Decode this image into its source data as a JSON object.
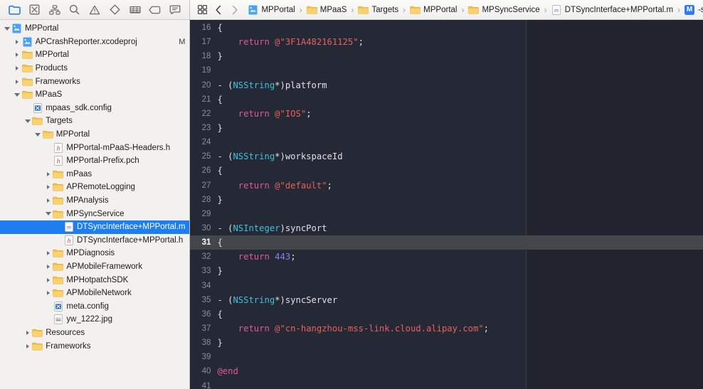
{
  "navigator": {
    "toolbar_icons": [
      {
        "name": "project-navigator-icon",
        "label": "Project Navigator",
        "selected": true
      },
      {
        "name": "source-control-navigator-icon",
        "label": "Source Control Navigator",
        "selected": false
      },
      {
        "name": "symbol-navigator-icon",
        "label": "Symbol Navigator",
        "selected": false
      },
      {
        "name": "find-navigator-icon",
        "label": "Find Navigator",
        "selected": false
      },
      {
        "name": "issue-navigator-icon",
        "label": "Issue Navigator",
        "selected": false
      },
      {
        "name": "test-navigator-icon",
        "label": "Test Navigator",
        "selected": false
      },
      {
        "name": "debug-navigator-icon",
        "label": "Debug Navigator",
        "selected": false
      },
      {
        "name": "breakpoint-navigator-icon",
        "label": "Breakpoint Navigator",
        "selected": false
      },
      {
        "name": "report-navigator-icon",
        "label": "Report Navigator",
        "selected": false
      }
    ],
    "tree": [
      {
        "label": "MPPortal",
        "depth": 0,
        "icon": "xcode-project",
        "state": "open",
        "selected": false,
        "badge": ""
      },
      {
        "label": "APCrashReporter.xcodeproj",
        "depth": 1,
        "icon": "xcode-project",
        "state": "closed",
        "selected": false,
        "badge": "M"
      },
      {
        "label": "MPPortal",
        "depth": 1,
        "icon": "folder",
        "state": "closed",
        "selected": false,
        "badge": ""
      },
      {
        "label": "Products",
        "depth": 1,
        "icon": "folder",
        "state": "closed",
        "selected": false,
        "badge": ""
      },
      {
        "label": "Frameworks",
        "depth": 1,
        "icon": "folder",
        "state": "closed",
        "selected": false,
        "badge": ""
      },
      {
        "label": "MPaaS",
        "depth": 1,
        "icon": "folder",
        "state": "open",
        "selected": false,
        "badge": ""
      },
      {
        "label": "mpaas_sdk.config",
        "depth": 2,
        "icon": "config",
        "state": "none",
        "selected": false,
        "badge": ""
      },
      {
        "label": "Targets",
        "depth": 2,
        "icon": "folder",
        "state": "open",
        "selected": false,
        "badge": ""
      },
      {
        "label": "MPPortal",
        "depth": 3,
        "icon": "folder",
        "state": "open",
        "selected": false,
        "badge": ""
      },
      {
        "label": "MPPortal-mPaaS-Headers.h",
        "depth": 4,
        "icon": "header",
        "state": "none",
        "selected": false,
        "badge": ""
      },
      {
        "label": "MPPortal-Prefix.pch",
        "depth": 4,
        "icon": "header",
        "state": "none",
        "selected": false,
        "badge": ""
      },
      {
        "label": "mPaas",
        "depth": 4,
        "icon": "folder",
        "state": "closed",
        "selected": false,
        "badge": ""
      },
      {
        "label": "APRemoteLogging",
        "depth": 4,
        "icon": "folder",
        "state": "closed",
        "selected": false,
        "badge": ""
      },
      {
        "label": "MPAnalysis",
        "depth": 4,
        "icon": "folder",
        "state": "closed",
        "selected": false,
        "badge": ""
      },
      {
        "label": "MPSyncService",
        "depth": 4,
        "icon": "folder",
        "state": "open",
        "selected": false,
        "badge": ""
      },
      {
        "label": "DTSyncInterface+MPPortal.m",
        "depth": 5,
        "icon": "source-m",
        "state": "none",
        "selected": true,
        "badge": ""
      },
      {
        "label": "DTSyncInterface+MPPortal.h",
        "depth": 5,
        "icon": "header",
        "state": "none",
        "selected": false,
        "badge": ""
      },
      {
        "label": "MPDiagnosis",
        "depth": 4,
        "icon": "folder",
        "state": "closed",
        "selected": false,
        "badge": ""
      },
      {
        "label": "APMobileFramework",
        "depth": 4,
        "icon": "folder",
        "state": "closed",
        "selected": false,
        "badge": ""
      },
      {
        "label": "MPHotpatchSDK",
        "depth": 4,
        "icon": "folder",
        "state": "closed",
        "selected": false,
        "badge": ""
      },
      {
        "label": "APMobileNetwork",
        "depth": 4,
        "icon": "folder",
        "state": "closed",
        "selected": false,
        "badge": ""
      },
      {
        "label": "meta.config",
        "depth": 4,
        "icon": "config",
        "state": "none",
        "selected": false,
        "badge": ""
      },
      {
        "label": "yw_1222.jpg",
        "depth": 4,
        "icon": "image",
        "state": "none",
        "selected": false,
        "badge": ""
      },
      {
        "label": "Resources",
        "depth": 2,
        "icon": "folder",
        "state": "closed",
        "selected": false,
        "badge": ""
      },
      {
        "label": "Frameworks",
        "depth": 2,
        "icon": "folder",
        "state": "closed",
        "selected": false,
        "badge": ""
      }
    ]
  },
  "jumpbar": {
    "related_items_icon": "related-items-icon",
    "back_icon": "chevron-left-icon",
    "forward_icon": "chevron-right-icon",
    "separator": "›",
    "breadcrumbs": [
      {
        "label": "MPPortal",
        "icon": "xcode-project"
      },
      {
        "label": "MPaaS",
        "icon": "folder"
      },
      {
        "label": "Targets",
        "icon": "folder"
      },
      {
        "label": "MPPortal",
        "icon": "folder"
      },
      {
        "label": "MPSyncService",
        "icon": "folder"
      },
      {
        "label": "DTSyncInterface+MPPortal.m",
        "icon": "source-m"
      },
      {
        "label": "-syncPort",
        "icon": "method-badge"
      }
    ],
    "method_badge_text": "M"
  },
  "editor": {
    "first_line_number": 16,
    "current_line": 31,
    "lines": [
      {
        "n": 16,
        "tokens": [
          {
            "t": "{",
            "c": "plain"
          }
        ]
      },
      {
        "n": 17,
        "tokens": [
          {
            "t": "    ",
            "c": "plain"
          },
          {
            "t": "return",
            "c": "kw"
          },
          {
            "t": " ",
            "c": "plain"
          },
          {
            "t": "@\"3F1A482161125\"",
            "c": "str"
          },
          {
            "t": ";",
            "c": "plain"
          }
        ]
      },
      {
        "n": 18,
        "tokens": [
          {
            "t": "}",
            "c": "plain"
          }
        ]
      },
      {
        "n": 19,
        "tokens": []
      },
      {
        "n": 20,
        "tokens": [
          {
            "t": "- (",
            "c": "plain"
          },
          {
            "t": "NSString",
            "c": "type"
          },
          {
            "t": "*)platform",
            "c": "plain"
          }
        ]
      },
      {
        "n": 21,
        "tokens": [
          {
            "t": "{",
            "c": "plain"
          }
        ]
      },
      {
        "n": 22,
        "tokens": [
          {
            "t": "    ",
            "c": "plain"
          },
          {
            "t": "return",
            "c": "kw"
          },
          {
            "t": " ",
            "c": "plain"
          },
          {
            "t": "@\"IOS\"",
            "c": "str"
          },
          {
            "t": ";",
            "c": "plain"
          }
        ]
      },
      {
        "n": 23,
        "tokens": [
          {
            "t": "}",
            "c": "plain"
          }
        ]
      },
      {
        "n": 24,
        "tokens": []
      },
      {
        "n": 25,
        "tokens": [
          {
            "t": "- (",
            "c": "plain"
          },
          {
            "t": "NSString",
            "c": "type"
          },
          {
            "t": "*)workspaceId",
            "c": "plain"
          }
        ]
      },
      {
        "n": 26,
        "tokens": [
          {
            "t": "{",
            "c": "plain"
          }
        ]
      },
      {
        "n": 27,
        "tokens": [
          {
            "t": "    ",
            "c": "plain"
          },
          {
            "t": "return",
            "c": "kw"
          },
          {
            "t": " ",
            "c": "plain"
          },
          {
            "t": "@\"default\"",
            "c": "str"
          },
          {
            "t": ";",
            "c": "plain"
          }
        ]
      },
      {
        "n": 28,
        "tokens": [
          {
            "t": "}",
            "c": "plain"
          }
        ]
      },
      {
        "n": 29,
        "tokens": []
      },
      {
        "n": 30,
        "tokens": [
          {
            "t": "- (",
            "c": "plain"
          },
          {
            "t": "NSInteger",
            "c": "type"
          },
          {
            "t": ")syncPort",
            "c": "plain"
          }
        ]
      },
      {
        "n": 31,
        "tokens": [
          {
            "t": "{",
            "c": "plain"
          }
        ]
      },
      {
        "n": 32,
        "tokens": [
          {
            "t": "    ",
            "c": "plain"
          },
          {
            "t": "return",
            "c": "kw"
          },
          {
            "t": " ",
            "c": "plain"
          },
          {
            "t": "443",
            "c": "num"
          },
          {
            "t": ";",
            "c": "plain"
          }
        ]
      },
      {
        "n": 33,
        "tokens": [
          {
            "t": "}",
            "c": "plain"
          }
        ]
      },
      {
        "n": 34,
        "tokens": []
      },
      {
        "n": 35,
        "tokens": [
          {
            "t": "- (",
            "c": "plain"
          },
          {
            "t": "NSString",
            "c": "type"
          },
          {
            "t": "*)syncServer",
            "c": "plain"
          }
        ]
      },
      {
        "n": 36,
        "tokens": [
          {
            "t": "{",
            "c": "plain"
          }
        ]
      },
      {
        "n": 37,
        "tokens": [
          {
            "t": "    ",
            "c": "plain"
          },
          {
            "t": "return",
            "c": "kw"
          },
          {
            "t": " ",
            "c": "plain"
          },
          {
            "t": "@\"cn-hangzhou-mss-link.cloud.alipay.com\"",
            "c": "str"
          },
          {
            "t": ";",
            "c": "plain"
          }
        ]
      },
      {
        "n": 38,
        "tokens": [
          {
            "t": "}",
            "c": "plain"
          }
        ]
      },
      {
        "n": 39,
        "tokens": []
      },
      {
        "n": 40,
        "tokens": [
          {
            "t": "@end",
            "c": "pre"
          }
        ]
      },
      {
        "n": 41,
        "tokens": []
      }
    ]
  },
  "colors": {
    "sidebar_bg": "#f2f1ef",
    "selection_blue": "#1e7ef0",
    "editor_bg": "#252936",
    "editor_bg_right": "#21242f",
    "current_line_bg": "#44474a",
    "keyword": "#e0559f",
    "string": "#e8605e",
    "type": "#41c0d8",
    "number": "#8a7ff0",
    "plain_text": "#dfe1e8",
    "line_number": "#8b8f9a"
  }
}
